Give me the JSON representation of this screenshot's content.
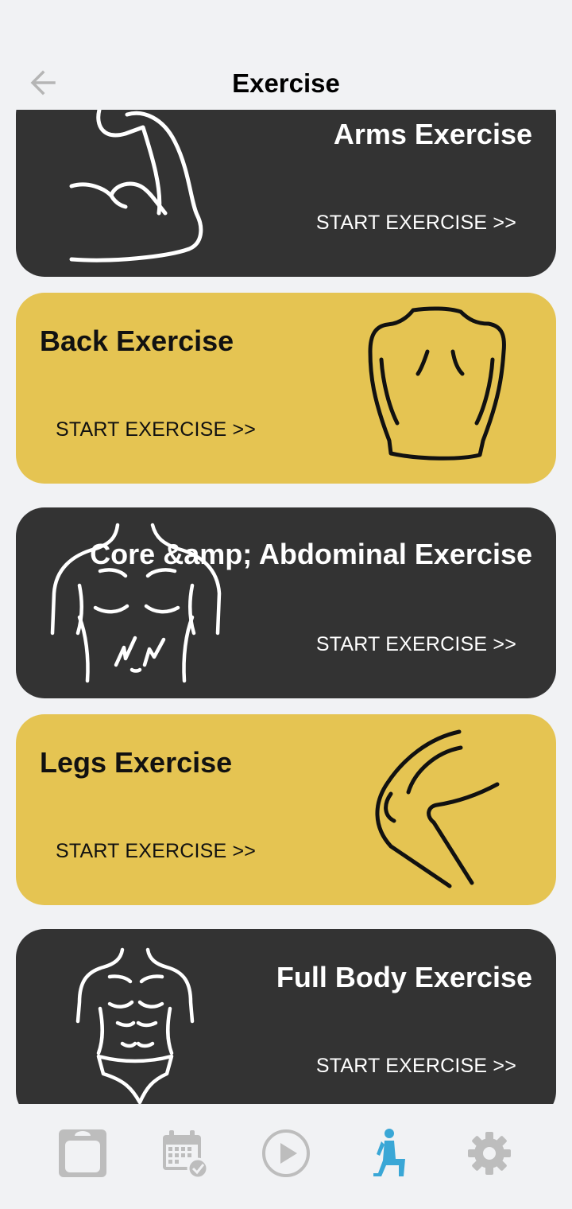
{
  "header": {
    "title": "Exercise",
    "back_icon": "arrow-left-icon"
  },
  "colors": {
    "dark_card": "#333333",
    "yellow_card": "#e5c452",
    "active_nav": "#3aa7d6",
    "inactive_nav": "#bdbdbd"
  },
  "cards": [
    {
      "title": "Arms Exercise",
      "cta": "START EXERCISE >>",
      "style": "dark",
      "illustration": "flexed-arm-icon"
    },
    {
      "title": "Back Exercise",
      "cta": "START EXERCISE >>",
      "style": "yellow",
      "illustration": "back-torso-icon"
    },
    {
      "title": "Core &amp; Abdominal Exercise",
      "cta": "START EXERCISE >>",
      "style": "dark",
      "illustration": "abdomen-icon"
    },
    {
      "title": "Legs Exercise",
      "cta": "START EXERCISE >>",
      "style": "yellow",
      "illustration": "leg-knee-icon"
    },
    {
      "title": "Full Body Exercise",
      "cta": "START EXERCISE >>",
      "style": "dark",
      "illustration": "full-body-icon"
    }
  ],
  "bottom_nav": [
    {
      "icon": "scale-icon",
      "active": false
    },
    {
      "icon": "calendar-check-icon",
      "active": false
    },
    {
      "icon": "play-circle-icon",
      "active": false
    },
    {
      "icon": "exercise-person-icon",
      "active": true
    },
    {
      "icon": "gear-icon",
      "active": false
    }
  ]
}
